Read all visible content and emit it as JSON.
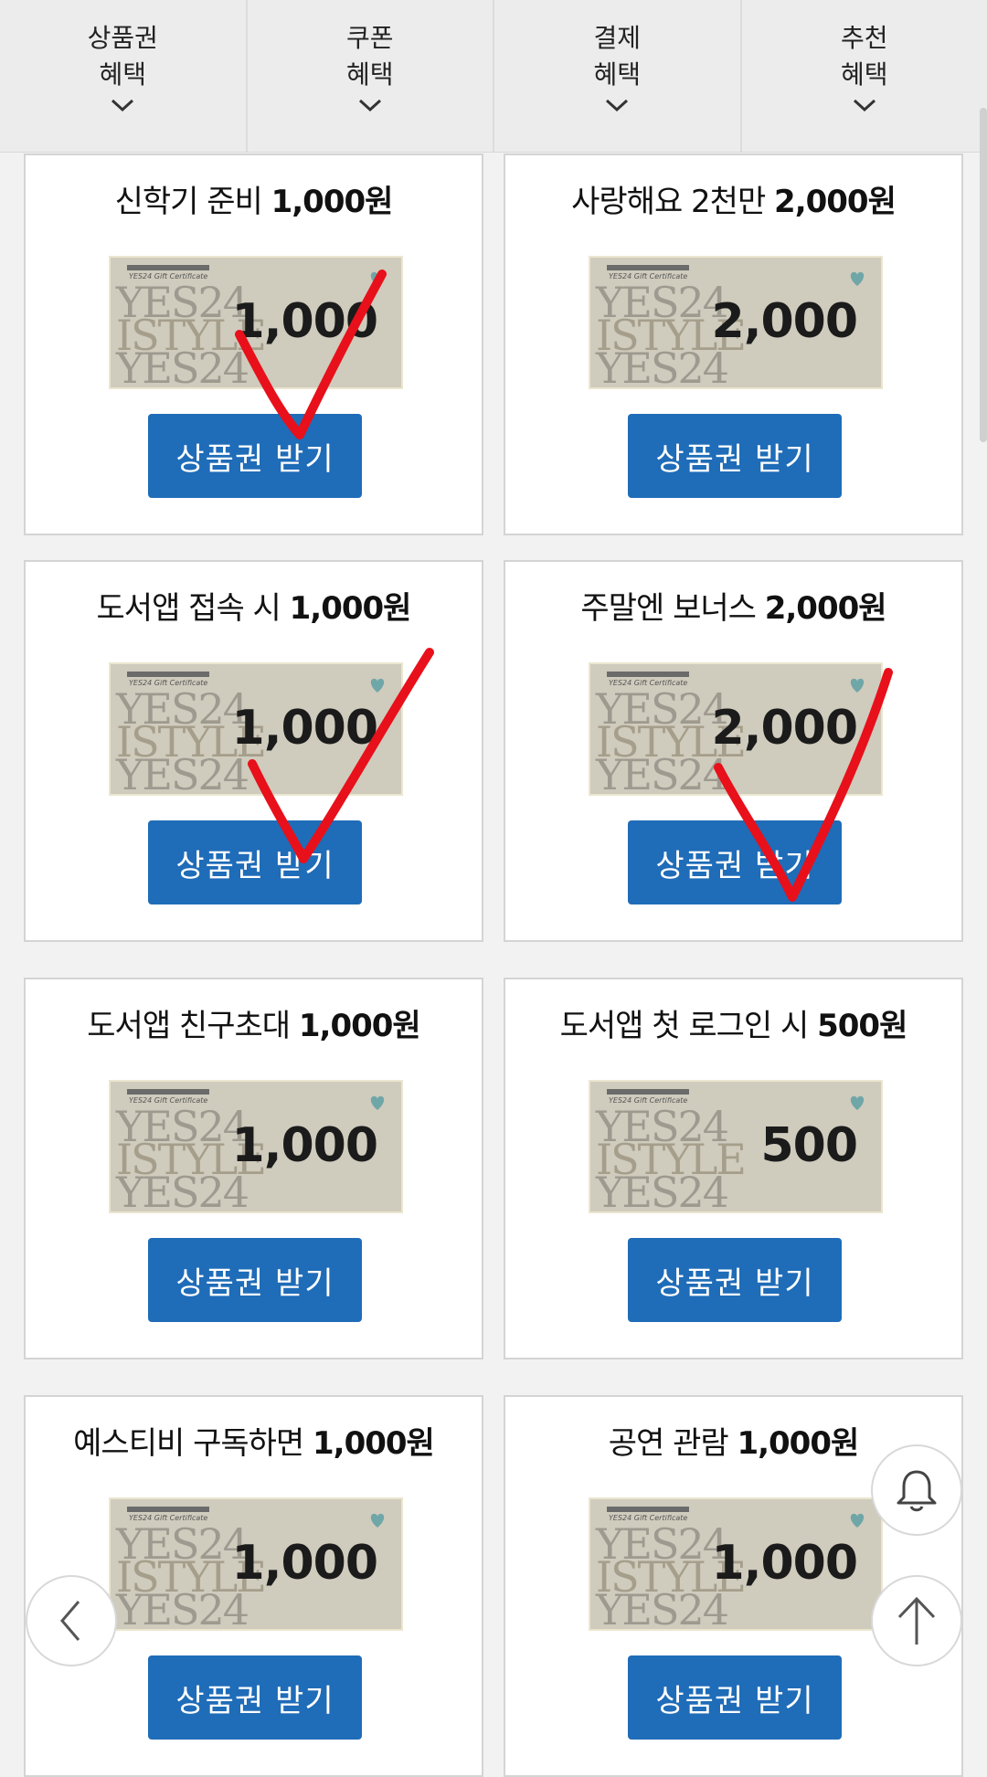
{
  "tabs": [
    {
      "line1": "상품권",
      "line2": "혜택"
    },
    {
      "line1": "쿠폰",
      "line2": "혜택"
    },
    {
      "line1": "결제",
      "line2": "혜택"
    },
    {
      "line1": "추천",
      "line2": "혜택"
    }
  ],
  "cards": [
    {
      "title": "신학기 준비",
      "amount_label": "1,000원",
      "cert_value": "1,000",
      "button": "상품권 받기"
    },
    {
      "title": "사랑해요 2천만",
      "amount_label": "2,000원",
      "cert_value": "2,000",
      "button": "상품권 받기"
    },
    {
      "title": "도서앱 접속 시",
      "amount_label": "1,000원",
      "cert_value": "1,000",
      "button": "상품권 받기"
    },
    {
      "title": "주말엔 보너스",
      "amount_label": "2,000원",
      "cert_value": "2,000",
      "button": "상품권 받기"
    },
    {
      "title": "도서앱 친구초대",
      "amount_label": "1,000원",
      "cert_value": "1,000",
      "button": "상품권 받기"
    },
    {
      "title": "도서앱 첫 로그인 시",
      "amount_label": "500원",
      "cert_value": "500",
      "button": "상품권 받기"
    },
    {
      "title": "예스티비 구독하면",
      "amount_label": "1,000원",
      "cert_value": "1,000",
      "button": "상품권 받기"
    },
    {
      "title": "공연 관람",
      "amount_label": "1,000원",
      "cert_value": "1,000",
      "button": "상품권 받기"
    }
  ],
  "certificate": {
    "brand": "YES24 Gift Certificate",
    "bg_line1": "YES24",
    "bg_line2": "ISTYLE",
    "bg_line3": "YES24"
  },
  "icons": {
    "tab_chevron": "chevron-down-icon",
    "notification": "bell-icon",
    "back": "chevron-left-icon",
    "scroll_top": "arrow-up-icon",
    "annotation": "red-checkmark"
  },
  "colors": {
    "button": "#1f6cb8",
    "check": "#e8101a",
    "tab_bg": "#ececec"
  }
}
